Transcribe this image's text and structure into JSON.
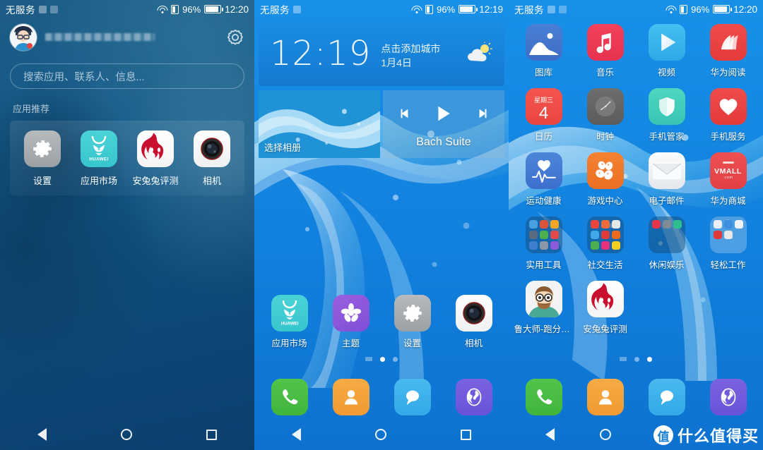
{
  "panels": {
    "drawer": {
      "status": {
        "carrier": "无服务",
        "battery": "96%",
        "time": "12:20"
      },
      "account_id": "",
      "search": {
        "placeholder": "搜索应用、联系人、信息..."
      },
      "section_title": "应用推荐",
      "recommended": [
        {
          "label": "设置",
          "icon": "settings-icon"
        },
        {
          "label": "应用市场",
          "icon": "huawei-appmarket-icon"
        },
        {
          "label": "安兔兔评测",
          "icon": "antutu-icon"
        },
        {
          "label": "相机",
          "icon": "camera-icon"
        }
      ],
      "nav": {
        "back": "back-button",
        "home": "home-button",
        "recent": "recents-button"
      }
    },
    "home1": {
      "status": {
        "carrier": "无服务",
        "battery": "96%",
        "time": "12:19"
      },
      "clock_widget": {
        "time": "12:19",
        "city_hint": "点击添加城市",
        "date": "1月4日",
        "weather_icon": "partly-cloudy-icon"
      },
      "album_widget": {
        "label": "选择相册"
      },
      "music_widget": {
        "title": "Bach Suite",
        "prev": "previous-track-icon",
        "play": "play-icon",
        "next": "next-track-icon"
      },
      "apps": [
        {
          "label": "应用市场",
          "icon": "huawei-appmarket-icon"
        },
        {
          "label": "主题",
          "icon": "themes-icon"
        },
        {
          "label": "设置",
          "icon": "settings-icon"
        },
        {
          "label": "相机",
          "icon": "camera-icon"
        }
      ],
      "page_dots": {
        "count": 3,
        "active": 1
      },
      "dock": [
        {
          "label": "",
          "icon": "phone-icon"
        },
        {
          "label": "",
          "icon": "contacts-icon"
        },
        {
          "label": "",
          "icon": "messages-icon"
        },
        {
          "label": "",
          "icon": "browser-icon"
        }
      ]
    },
    "home2": {
      "status": {
        "carrier": "无服务",
        "battery": "96%",
        "time": "12:20"
      },
      "apps": [
        {
          "label": "图库",
          "icon": "gallery-icon"
        },
        {
          "label": "音乐",
          "icon": "music-icon"
        },
        {
          "label": "视频",
          "icon": "video-icon"
        },
        {
          "label": "华为阅读",
          "icon": "huawei-reader-icon"
        },
        {
          "label": "日历",
          "icon": "calendar-icon",
          "weekday": "星期三",
          "day": "4"
        },
        {
          "label": "时钟",
          "icon": "clock-icon"
        },
        {
          "label": "手机管家",
          "icon": "phone-manager-icon"
        },
        {
          "label": "手机服务",
          "icon": "phone-service-icon"
        },
        {
          "label": "运动健康",
          "icon": "health-icon"
        },
        {
          "label": "游戏中心",
          "icon": "game-center-icon"
        },
        {
          "label": "电子邮件",
          "icon": "email-icon"
        },
        {
          "label": "华为商城",
          "icon": "vmall-icon",
          "badge": "VMALL",
          "badge_sub": ".com"
        },
        {
          "label": "实用工具",
          "icon": "folder-icon"
        },
        {
          "label": "社交生活",
          "icon": "folder-icon"
        },
        {
          "label": "休闲娱乐",
          "icon": "folder-icon"
        },
        {
          "label": "轻松工作",
          "icon": "folder-icon"
        },
        {
          "label": "鲁大师-跑分清..",
          "icon": "ludashi-icon"
        },
        {
          "label": "安兔兔评测",
          "icon": "antutu-icon"
        }
      ],
      "page_dots": {
        "count": 3,
        "active": 2
      },
      "dock": [
        {
          "label": "",
          "icon": "phone-icon"
        },
        {
          "label": "",
          "icon": "contacts-icon"
        },
        {
          "label": "",
          "icon": "messages-icon"
        },
        {
          "label": "",
          "icon": "browser-icon"
        }
      ]
    }
  },
  "watermark": {
    "badge": "值",
    "text": "什么值得买"
  },
  "colors": {
    "status_blue": "#1890e8",
    "drawer_blue": "#125987",
    "accent_red": "#e43a3a",
    "accent_green": "#41b43c",
    "accent_orange": "#f09a32"
  }
}
